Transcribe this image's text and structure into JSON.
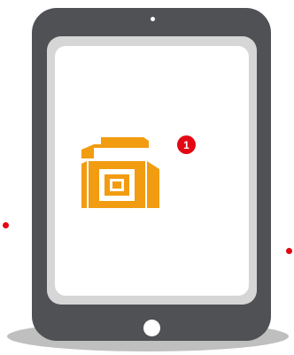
{
  "colors": {
    "background": "#ffffff",
    "tablet_body": "#4f5154",
    "tablet_shadow": "#bfbfbf",
    "screen_frame": "#d6d6d6",
    "screen_inner": "#ffffff",
    "home_button": "#ffffff",
    "camera": "#ffffff",
    "phone_icon": "#f29c11",
    "badge": "#e30613",
    "side_dot": "#e30613"
  },
  "icon": "telephone-icon",
  "notification": {
    "count": "1"
  }
}
